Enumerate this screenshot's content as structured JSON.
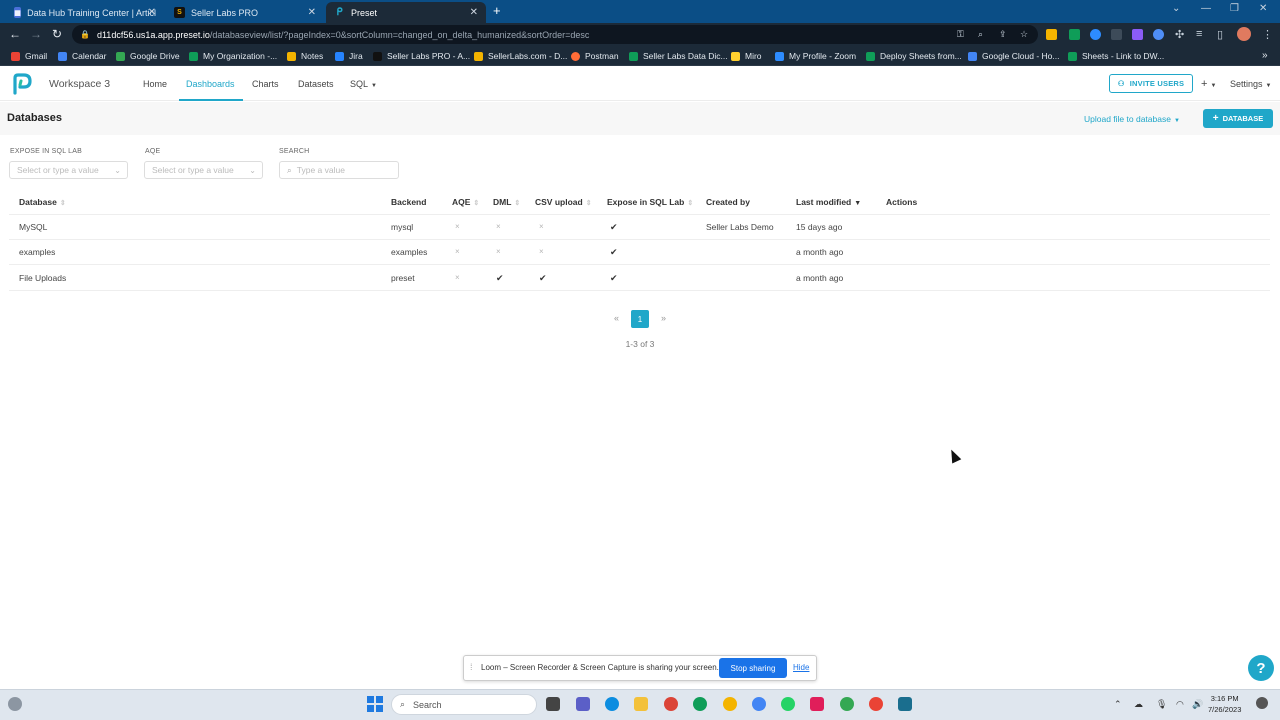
{
  "browser": {
    "tabs": [
      {
        "title": "Data Hub Training Center | Articl",
        "active": false
      },
      {
        "title": "Seller Labs PRO",
        "active": false
      },
      {
        "title": "Preset",
        "active": true
      }
    ],
    "new_tab": "+",
    "url_host": "d11dcf56.us1a.app.preset.io",
    "url_path": "/databaseview/list/?pageIndex=0&sortColumn=changed_on_delta_humanized&sortOrder=desc",
    "bookmarks": [
      {
        "label": "Gmail",
        "color": "#ea4335"
      },
      {
        "label": "Calendar",
        "color": "#4285f4"
      },
      {
        "label": "Google Drive",
        "color": "#34a853"
      },
      {
        "label": "My Organization -...",
        "color": "#0f9d58"
      },
      {
        "label": "Notes",
        "color": "#f4b400"
      },
      {
        "label": "Jira",
        "color": "#2684ff"
      },
      {
        "label": "Seller Labs PRO - A...",
        "color": "#111111"
      },
      {
        "label": "SellerLabs.com - D...",
        "color": "#f4b400"
      },
      {
        "label": "Postman",
        "color": "#ff6c37"
      },
      {
        "label": "Seller Labs Data Dic...",
        "color": "#0f9d58"
      },
      {
        "label": "Miro",
        "color": "#ffd02f"
      },
      {
        "label": "My Profile - Zoom",
        "color": "#2d8cff"
      },
      {
        "label": "Deploy Sheets from...",
        "color": "#0f9d58"
      },
      {
        "label": "Google Cloud - Ho...",
        "color": "#4285f4"
      },
      {
        "label": "Sheets - Link to DW...",
        "color": "#0f9d58"
      }
    ]
  },
  "app": {
    "workspace": "Workspace 3",
    "nav": [
      "Home",
      "Dashboards",
      "Charts",
      "Datasets",
      "SQL"
    ],
    "nav_active": "Dashboards",
    "invite": "INVITE USERS",
    "plus_menu": "+",
    "settings": "Settings",
    "accent": "#20a7c9"
  },
  "page": {
    "title": "Databases",
    "upload": "Upload file to database",
    "add_database": "DATABASE",
    "filters": [
      {
        "label": "EXPOSE IN SQL LAB",
        "placeholder": "Select or type a value"
      },
      {
        "label": "AQE",
        "placeholder": "Select or type a value"
      },
      {
        "label": "SEARCH",
        "placeholder": "Type a value"
      }
    ]
  },
  "table": {
    "columns": [
      "Database",
      "Backend",
      "AQE",
      "DML",
      "CSV upload",
      "Expose in SQL Lab",
      "Created by",
      "Last modified",
      "Actions"
    ],
    "rows": [
      {
        "database": "MySQL",
        "backend": "mysql",
        "aqe": false,
        "dml": false,
        "csv": false,
        "expose": true,
        "created_by": "Seller Labs Demo",
        "modified": "15 days ago"
      },
      {
        "database": "examples",
        "backend": "examples",
        "aqe": false,
        "dml": false,
        "csv": false,
        "expose": true,
        "created_by": "",
        "modified": "a month ago"
      },
      {
        "database": "File Uploads",
        "backend": "preset",
        "aqe": false,
        "dml": true,
        "csv": true,
        "expose": true,
        "created_by": "",
        "modified": "a month ago"
      }
    ],
    "glyph_yes": "✔",
    "glyph_no": "×"
  },
  "pagination": {
    "prev": "«",
    "current": "1",
    "next": "»",
    "count": "1-3 of 3"
  },
  "loom": {
    "text": "Loom – Screen Recorder & Screen Capture is sharing your screen.",
    "stop": "Stop sharing",
    "hide": "Hide"
  },
  "help": "?",
  "taskbar": {
    "search": "Search",
    "time": "3:16 PM",
    "date": "7/26/2023"
  }
}
